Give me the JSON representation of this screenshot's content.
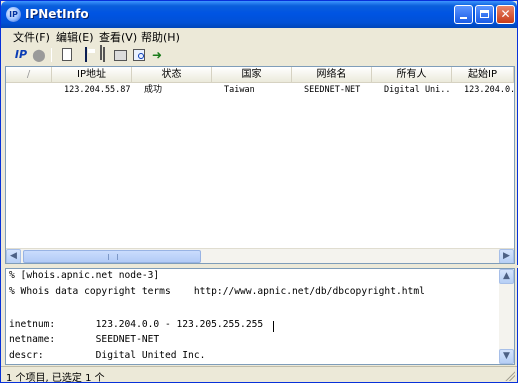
{
  "window": {
    "icon_text": "IP",
    "title": "IPNetInfo"
  },
  "menu": [
    "文件(F)",
    "编辑(E)",
    "查看(V)",
    "帮助(H)"
  ],
  "toolbar": {
    "ip_label": "IP",
    "icons": [
      "ip-lookup-icon",
      "stop-icon",
      "new-document-icon",
      "save-icon",
      "copy-icon",
      "properties-icon",
      "find-icon",
      "exit-icon"
    ]
  },
  "table": {
    "columns": [
      "/",
      "IP地址",
      "状态",
      "国家",
      "网络名",
      "所有人",
      "起始IP"
    ],
    "rows": [
      {
        "ip": "123.204.55.87",
        "status": "成功",
        "country": "Taiwan",
        "netname": "SEEDNET-NET",
        "owner": "Digital Uni...",
        "start_ip": "123.204.0."
      }
    ]
  },
  "whois": {
    "lines": [
      "% [whois.apnic.net node-3]",
      "% Whois data copyright terms    http://www.apnic.net/db/dbcopyright.html",
      "",
      "inetnum:       123.204.0.0 - 123.205.255.255",
      "netname:       SEEDNET-NET",
      "descr:         Digital United Inc."
    ]
  },
  "status_bar": "1 个项目, 已选定 1 个"
}
